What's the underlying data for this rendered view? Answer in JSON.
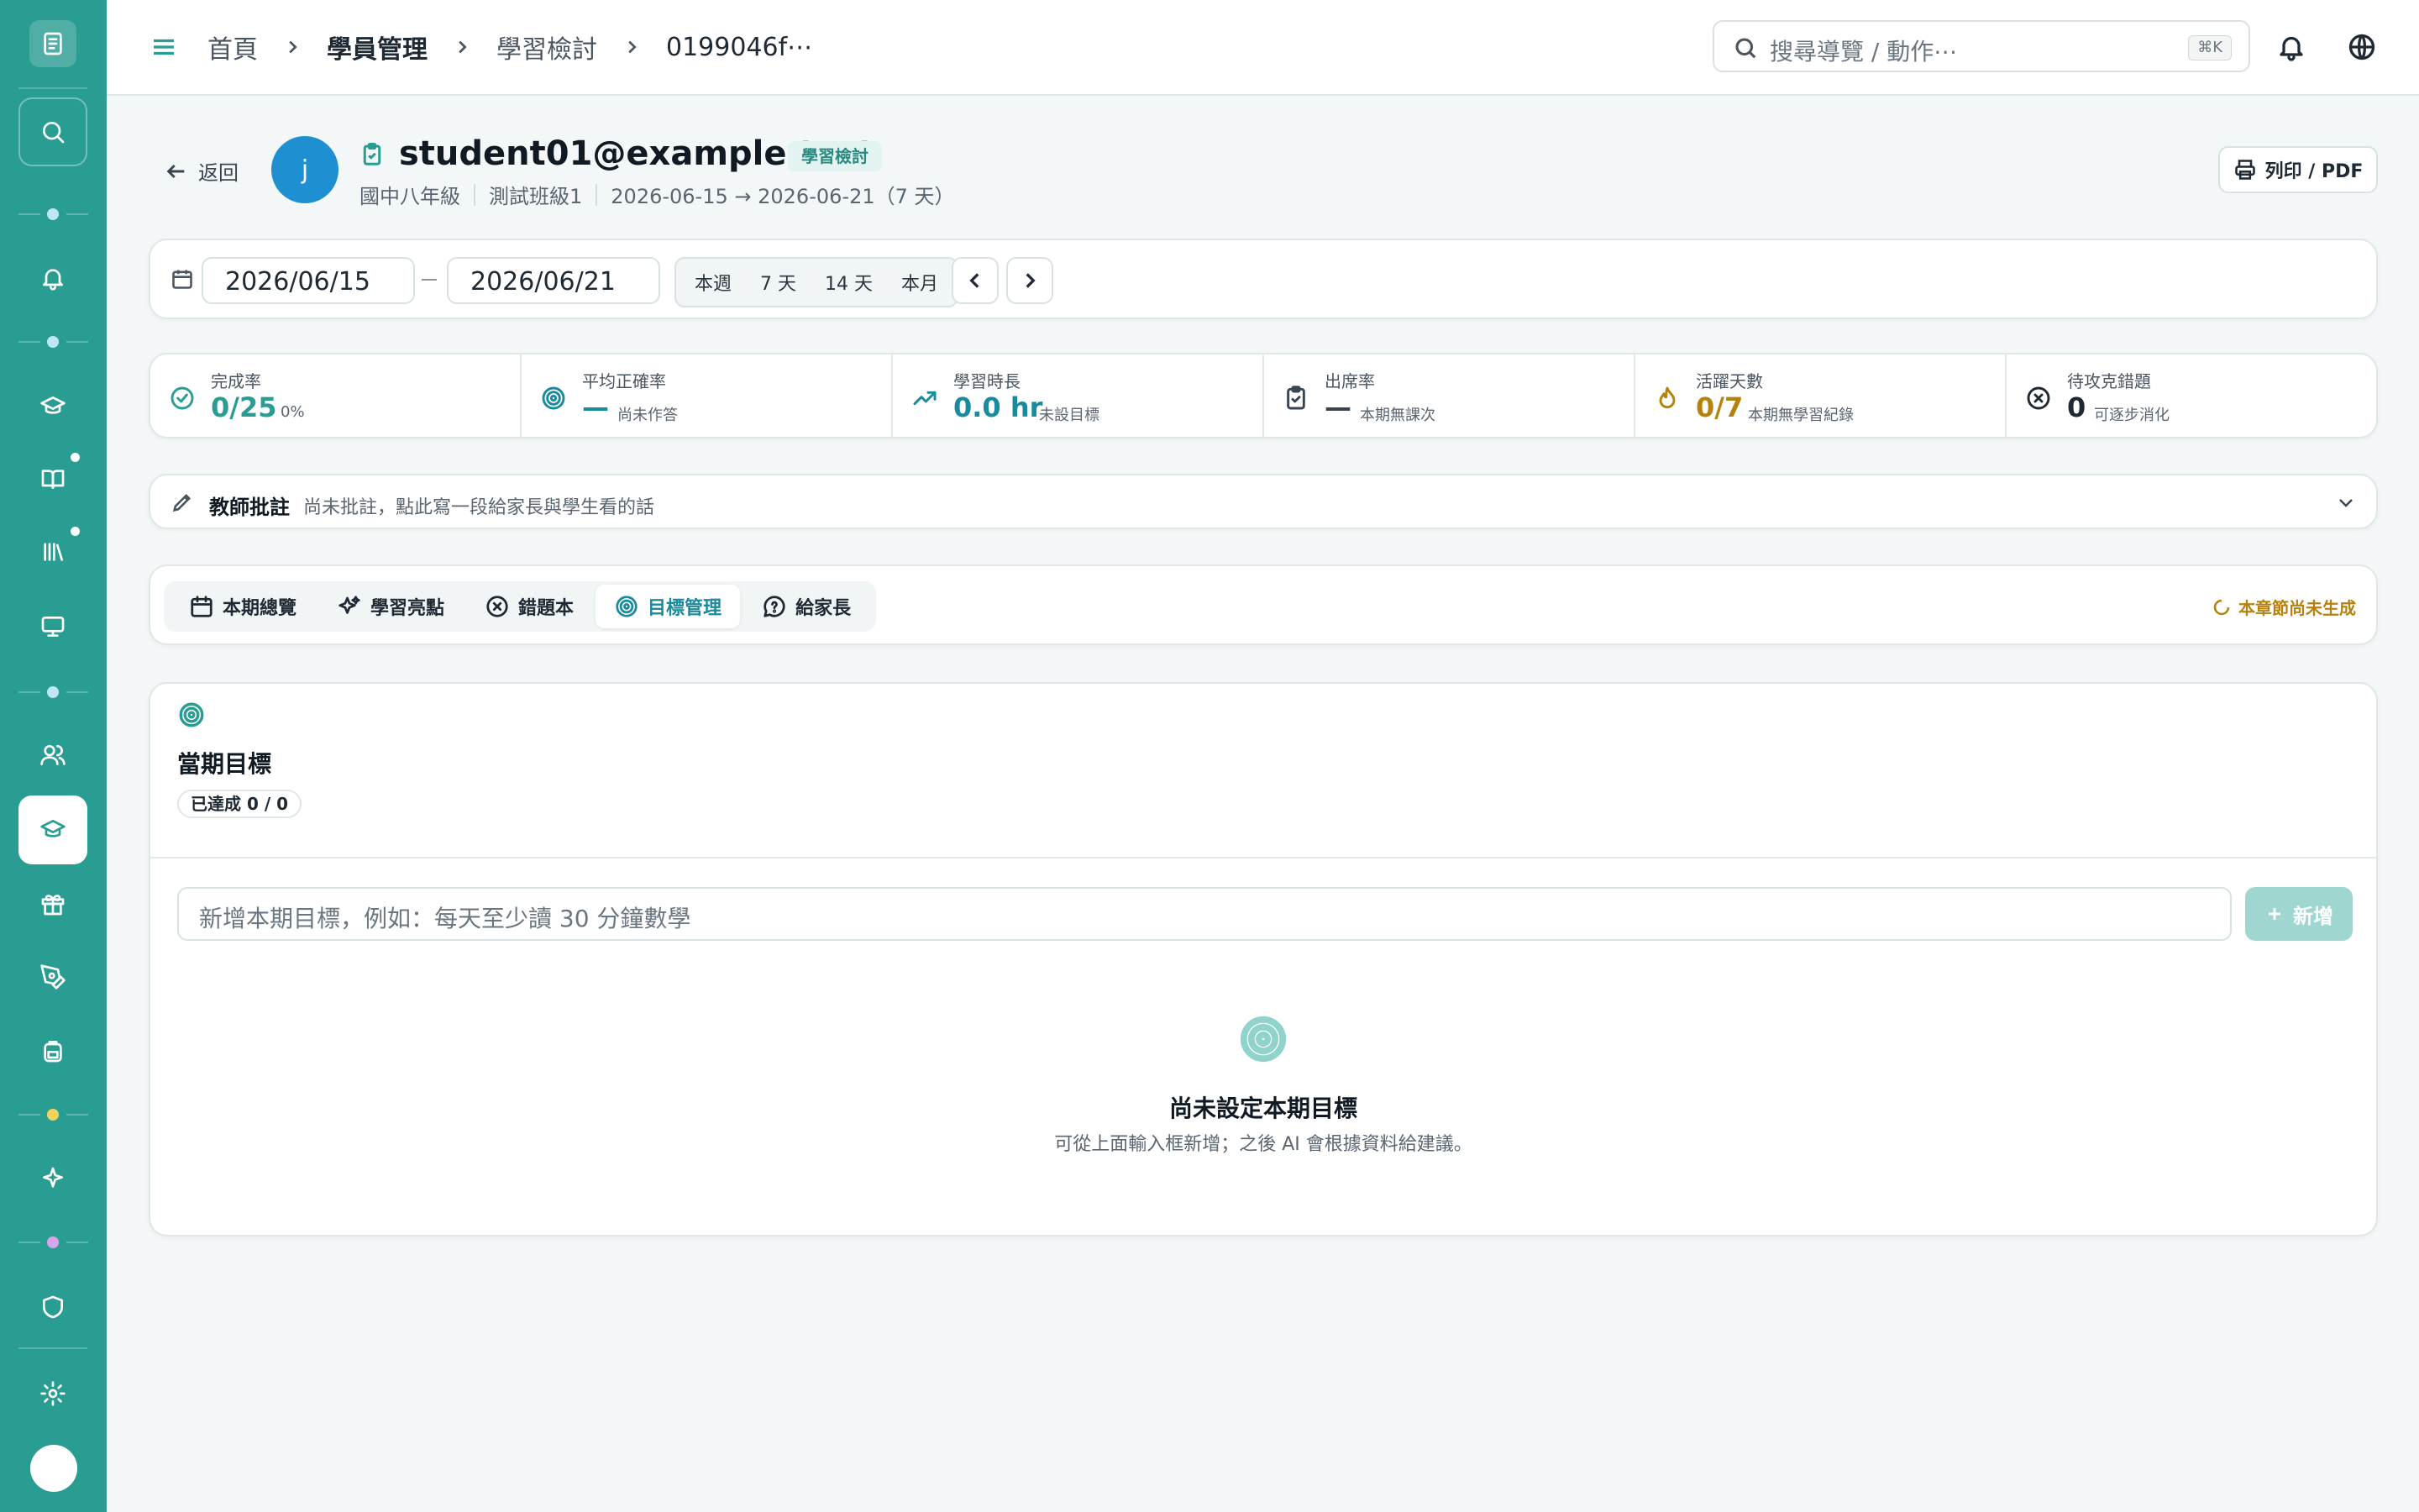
{
  "breadcrumb": {
    "items": [
      "首頁",
      "學員管理",
      "學習檢討",
      "0199046f⋯"
    ]
  },
  "search": {
    "placeholder": "搜尋導覽 / 動作⋯",
    "shortcut": "⌘K"
  },
  "header": {
    "back_label": "返回",
    "avatar_initial": "j",
    "student_name": "student01@example.test",
    "badge": "學習檢討",
    "grade": "國中八年級",
    "class_name": "測試班級1",
    "period": "2026-06-15 → 2026-06-21（7 天）",
    "print_label": "列印 / PDF"
  },
  "date_range": {
    "start": "2026/06/15",
    "end": "2026/06/21",
    "presets": [
      "本週",
      "7 天",
      "14 天",
      "本月"
    ]
  },
  "stats": [
    {
      "label": "完成率",
      "value": "0/25",
      "sub": "0%",
      "icon": "check-circle-icon",
      "color": "#2a9d93"
    },
    {
      "label": "平均正確率",
      "value": "—",
      "sub": "尚未作答",
      "icon": "target-icon",
      "color": "#1a8a9e"
    },
    {
      "label": "學習時長",
      "value": "0.0 hr",
      "sub": "未設目標",
      "icon": "trending-up-icon",
      "color": "#1a8a9e"
    },
    {
      "label": "出席率",
      "value": "—",
      "sub": "本期無課次",
      "icon": "clipboard-icon",
      "color": "#3a4550"
    },
    {
      "label": "活躍天數",
      "value": "0/7",
      "sub": "本期無學習紀錄",
      "icon": "flame-icon",
      "color": "#b5820e"
    },
    {
      "label": "待攻克錯題",
      "value": "0",
      "sub": "可逐步消化",
      "icon": "x-circle-icon",
      "color": "#1f2933"
    }
  ],
  "teacher_note": {
    "title": "教師批註",
    "hint": "尚未批註，點此寫一段給家長與學生看的話"
  },
  "tabs": [
    {
      "label": "本期總覽",
      "icon": "calendar-icon",
      "active": false
    },
    {
      "label": "學習亮點",
      "icon": "sparkles-icon",
      "active": false
    },
    {
      "label": "錯題本",
      "icon": "x-circle-icon",
      "active": false
    },
    {
      "label": "目標管理",
      "icon": "target-icon",
      "active": true
    },
    {
      "label": "給家長",
      "icon": "message-question-icon",
      "active": false
    }
  ],
  "generation_status": "本章節尚未生成",
  "goals": {
    "title": "當期目標",
    "achieved": "已達成 0 / 0",
    "input_placeholder": "新增本期目標，例如：每天至少讀 30 分鐘數學",
    "add_label": "新增",
    "empty_title": "尚未設定本期目標",
    "empty_subtitle": "可從上面輸入框新增；之後 AI 會根據資料給建議。"
  },
  "colors": {
    "primary": "#2a9d93",
    "accent_blue": "#1e8fd0",
    "warning": "#b5820e"
  }
}
